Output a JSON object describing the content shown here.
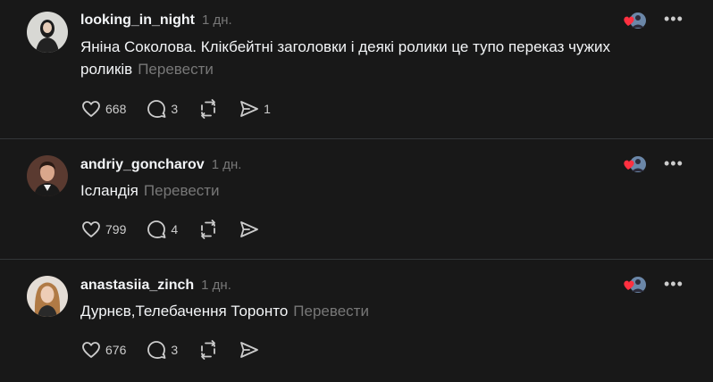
{
  "colors": {
    "background": "#181818",
    "text_primary": "#f3f5f7",
    "text_muted": "#777777",
    "divider": "#333638",
    "like_heart": "#ff3040"
  },
  "posts": [
    {
      "username": "looking_in_night",
      "time": "1 дн.",
      "text": "Яніна Соколова. Клікбейтні заголовки і деякі ролики це тупо переказ чужих роликів",
      "translate": "Перевести",
      "likes": "668",
      "replies": "3",
      "shares": "1",
      "icons": [
        "heart-icon",
        "comment-icon",
        "repost-icon",
        "share-icon"
      ]
    },
    {
      "username": "andriy_goncharov",
      "time": "1 дн.",
      "text": "Ісландія",
      "translate": "Перевести",
      "likes": "799",
      "replies": "4",
      "shares": "",
      "icons": [
        "heart-icon",
        "comment-icon",
        "repost-icon",
        "share-icon"
      ]
    },
    {
      "username": "anastasiia_zinch",
      "time": "1 дн.",
      "text": "Дурнєв,Телебачення Торонто",
      "translate": "Перевести",
      "likes": "676",
      "replies": "3",
      "shares": "",
      "icons": [
        "heart-icon",
        "comment-icon",
        "repost-icon",
        "share-icon"
      ]
    }
  ],
  "more_label": "•••"
}
